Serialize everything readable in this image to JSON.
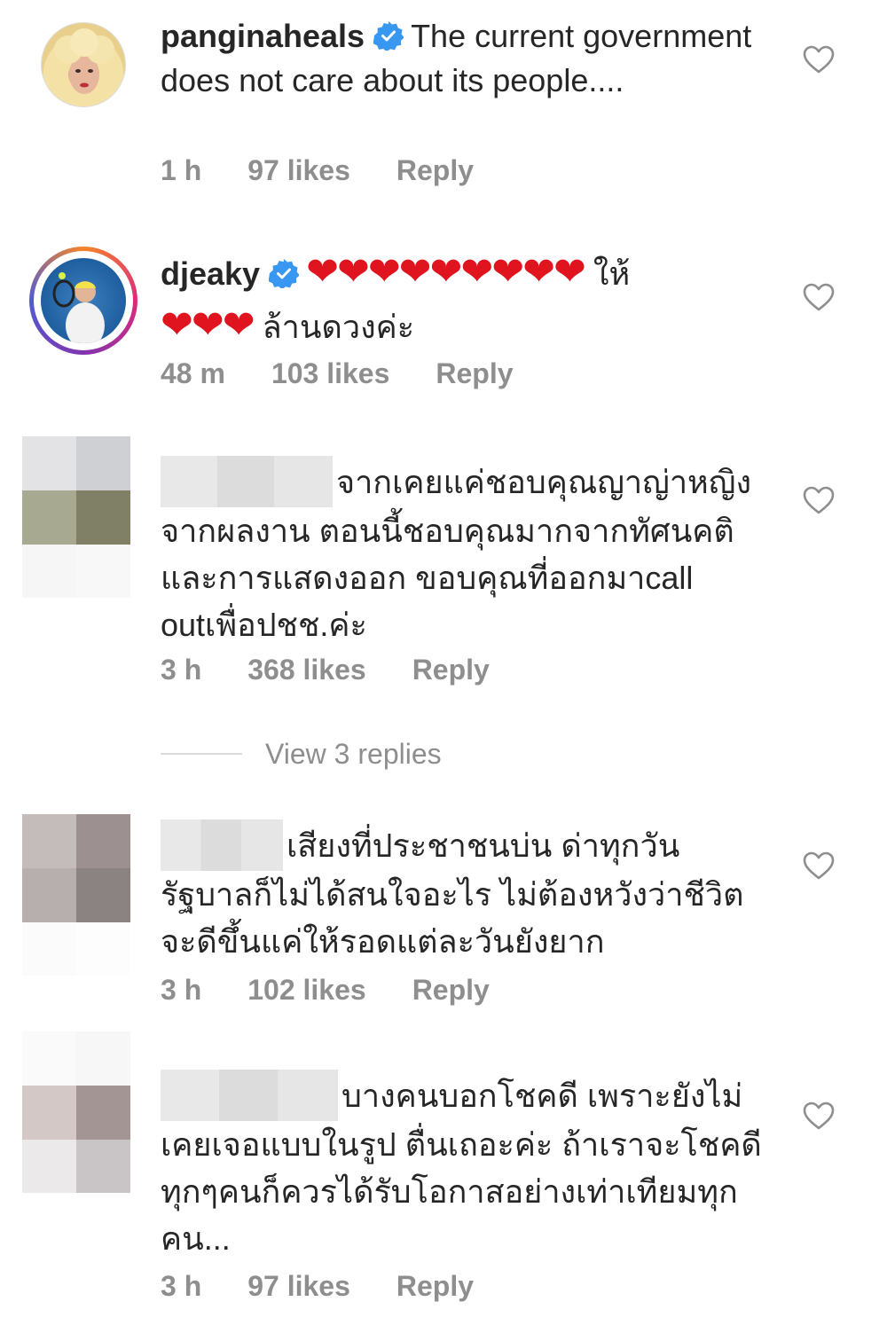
{
  "comments": [
    {
      "username": "panginaheals",
      "text": "The current government does not care about its people....",
      "time": "1 h",
      "likes": "97 likes",
      "reply": "Reply"
    },
    {
      "username": "djeaky",
      "hearts_a": "❤❤❤❤❤❤❤❤❤",
      "text_a": "ให้",
      "hearts_b": "❤❤❤",
      "text_b": "ล้านดวงค่ะ",
      "time": "48 m",
      "likes": "103 likes",
      "reply": "Reply"
    },
    {
      "text": "จากเคยแค่ชอบคุณญาญ่าหญิงจากผลงาน ตอนนี้ชอบคุณมากจากทัศนคติและการแสดงออก ขอบคุณที่ออกมาcall outเพื่อปชช.ค่ะ",
      "time": "3 h",
      "likes": "368 likes",
      "reply": "Reply",
      "view_replies": "View 3 replies"
    },
    {
      "text": "เสียงที่ประชาชนบ่น ด่าทุกวัน รัฐบาลก็ไม่ได้สนใจอะไร ไม่ต้องหวังว่าชีวิตจะดีขึ้นแค่ให้รอดแต่ละวันยังยาก",
      "time": "3 h",
      "likes": "102 likes",
      "reply": "Reply"
    },
    {
      "text": "บางคนบอกโชคดี เพราะยังไม่เคยเจอแบบในรูป ตื่นเถอะค่ะ ถ้าเราจะโชคดี ทุกๆคนก็ควรได้รับโอกาสอย่างเท่าเทียมทุกคน...",
      "time": "3 h",
      "likes": "97 likes",
      "reply": "Reply"
    }
  ],
  "icons": {
    "verified": "verified-badge-icon",
    "like": "heart-outline-icon"
  },
  "colors": {
    "text": "#262626",
    "meta": "#8e8e8e",
    "verified": "#3897f0",
    "heart": "#e0141e"
  }
}
